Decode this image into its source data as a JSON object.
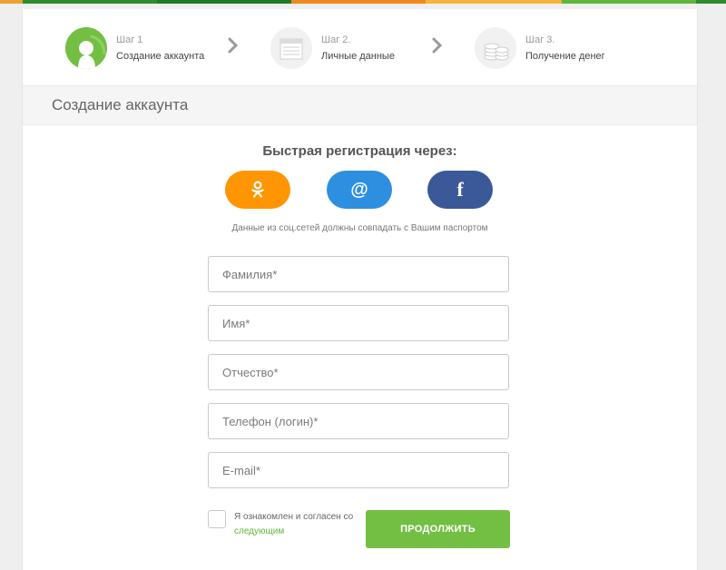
{
  "colors": {
    "top_bar": [
      "#f0a030",
      "#2e8b2e",
      "#f0a030",
      "#f0c060",
      "#5fb63a",
      "#2e8b2e"
    ],
    "accent_green": "#72bf44",
    "ok_orange": "#ff9500",
    "mail_blue": "#2d8fe0",
    "facebook_blue": "#3b5998"
  },
  "steps": [
    {
      "number": "Шаг 1",
      "name": "Создание аккаунта",
      "icon": "user-icon",
      "active": true
    },
    {
      "number": "Шаг 2.",
      "name": "Личные данные",
      "icon": "document-icon",
      "active": false
    },
    {
      "number": "Шаг 3.",
      "name": "Получение денег",
      "icon": "coins-icon",
      "active": false
    }
  ],
  "section_title": "Создание аккаунта",
  "quick_reg": {
    "title": "Быстрая регистрация через:",
    "buttons": [
      {
        "name": "odnoklassniki-icon"
      },
      {
        "label": "@",
        "name": "mailru-icon"
      },
      {
        "label": "f",
        "name": "facebook-icon"
      }
    ],
    "note": "Данные из соц.сетей должны совпадать с Вашим паспортом"
  },
  "form": {
    "fields": [
      {
        "placeholder": "Фамилия*",
        "value": ""
      },
      {
        "placeholder": "Имя*",
        "value": ""
      },
      {
        "placeholder": "Отчество*",
        "value": ""
      },
      {
        "placeholder": "Телефон (логин)*",
        "value": ""
      },
      {
        "placeholder": "E-mail*",
        "value": ""
      }
    ],
    "agree_text": "Я ознакомлен и согласен со",
    "agree_link": "следующим",
    "submit_label": "ПРОДОЛЖИТЬ"
  }
}
